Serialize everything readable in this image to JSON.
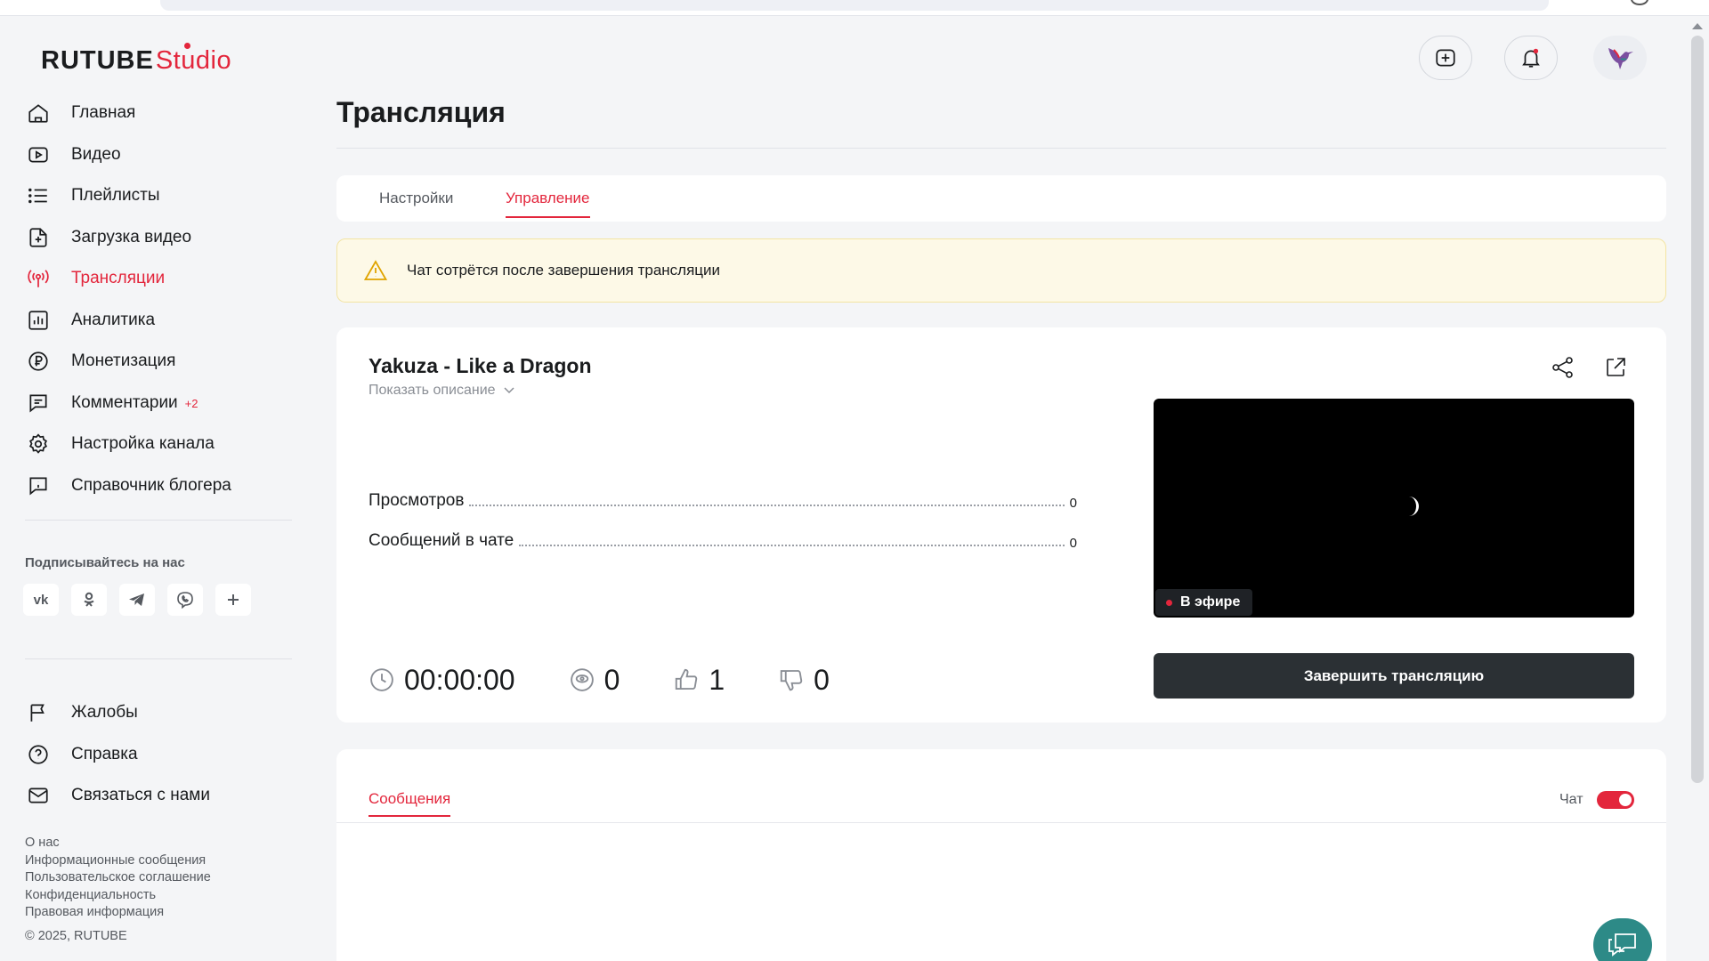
{
  "app": {
    "logo_main": "RUTUBE",
    "logo_sub": "Studio"
  },
  "sidebar": {
    "items": [
      {
        "label": "Главная",
        "icon": "home-icon"
      },
      {
        "label": "Видео",
        "icon": "video-icon"
      },
      {
        "label": "Плейлисты",
        "icon": "playlist-icon"
      },
      {
        "label": "Загрузка видео",
        "icon": "upload-icon"
      },
      {
        "label": "Трансляции",
        "icon": "broadcast-icon",
        "active": true
      },
      {
        "label": "Аналитика",
        "icon": "analytics-icon"
      },
      {
        "label": "Монетизация",
        "icon": "ruble-icon"
      },
      {
        "label": "Комментарии",
        "icon": "comments-icon",
        "badge": "+2"
      },
      {
        "label": "Настройка канала",
        "icon": "gear-icon"
      },
      {
        "label": "Справочник блогера",
        "icon": "info-book-icon"
      }
    ],
    "follow_title": "Подписывайтесь на нас",
    "socials": [
      {
        "label": "vk",
        "icon": "vk-icon"
      },
      {
        "label": "ok",
        "icon": "odnoklassniki-icon"
      },
      {
        "label": "tg",
        "icon": "telegram-icon"
      },
      {
        "label": "viber",
        "icon": "viber-icon"
      },
      {
        "label": "+",
        "icon": "plus-icon"
      }
    ],
    "secondary": [
      {
        "label": "Жалобы",
        "icon": "flag-icon"
      },
      {
        "label": "Справка",
        "icon": "help-icon"
      },
      {
        "label": "Связаться с нами",
        "icon": "mail-icon"
      }
    ],
    "footer_links": [
      "О нас",
      "Информационные сообщения",
      "Пользовательское соглашение",
      "Конфиденциальность",
      "Правовая информация"
    ],
    "copyright": "© 2025, RUTUBE"
  },
  "header": {
    "title": "Трансляция",
    "buttons": [
      "upload-plus-icon",
      "bell-icon",
      "avatar"
    ]
  },
  "tabs": [
    {
      "label": "Настройки",
      "active": false
    },
    {
      "label": "Управление",
      "active": true
    }
  ],
  "warning": {
    "text": "Чат сотрётся после завершения трансляции",
    "icon": "warning-icon"
  },
  "stream": {
    "title": "Yakuza - Like a Dragon",
    "show_description": "Показать описание",
    "stats": [
      {
        "label": "Просмотров",
        "value": "0"
      },
      {
        "label": "Сообщений в чате",
        "value": "0"
      }
    ],
    "live_badge": "В эфире",
    "metrics": {
      "duration": "00:00:00",
      "viewers": "0",
      "likes": "1",
      "dislikes": "0"
    },
    "end_button": "Завершить трансляцию"
  },
  "chat": {
    "tab_label": "Сообщения",
    "toggle_label": "Чат",
    "toggle_on": true
  },
  "colors": {
    "accent": "#e3263c",
    "dark_button": "#2b3034",
    "warning_bg": "#fdf9e7",
    "help_fab": "#2d8a87"
  }
}
